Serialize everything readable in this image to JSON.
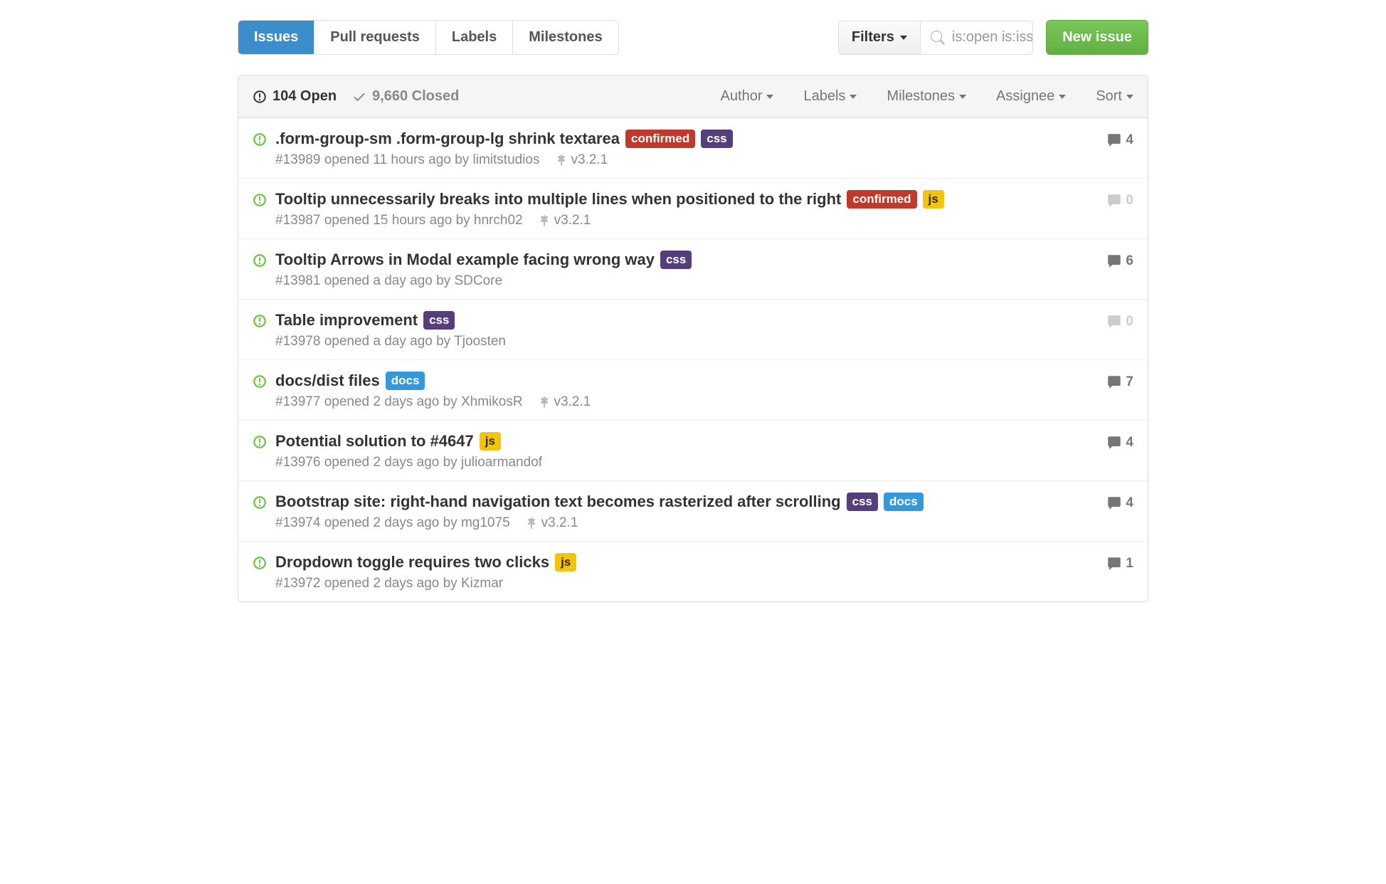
{
  "nav": {
    "issues": "Issues",
    "pull_requests": "Pull requests",
    "labels": "Labels",
    "milestones": "Milestones"
  },
  "filters_button": "Filters",
  "search_value": "is:open is:issue",
  "new_issue_button": "New issue",
  "toolbar": {
    "open_count": "104 Open",
    "closed_count": "9,660 Closed",
    "menus": {
      "author": "Author",
      "labels": "Labels",
      "milestones": "Milestones",
      "assignee": "Assignee",
      "sort": "Sort"
    }
  },
  "label_colors": {
    "confirmed": "#c0392b",
    "css": "#563d7c",
    "js": "#f1c40f",
    "docs": "#3498db"
  },
  "issues": [
    {
      "title": ".form-group-sm .form-group-lg shrink textarea",
      "labels": [
        "confirmed",
        "css"
      ],
      "number": "#13989",
      "opened": "opened 11 hours ago by",
      "author": "limitstudios",
      "milestone": "v3.2.1",
      "comments": "4",
      "has_comments": true
    },
    {
      "title": "Tooltip unnecessarily breaks into multiple lines when positioned to the right",
      "labels": [
        "confirmed",
        "js"
      ],
      "number": "#13987",
      "opened": "opened 15 hours ago by",
      "author": "hnrch02",
      "milestone": "v3.2.1",
      "comments": "0",
      "has_comments": false
    },
    {
      "title": "Tooltip Arrows in Modal example facing wrong way",
      "labels": [
        "css"
      ],
      "number": "#13981",
      "opened": "opened a day ago by",
      "author": "SDCore",
      "milestone": "",
      "comments": "6",
      "has_comments": true
    },
    {
      "title": "Table improvement",
      "labels": [
        "css"
      ],
      "number": "#13978",
      "opened": "opened a day ago by",
      "author": "Tjoosten",
      "milestone": "",
      "comments": "0",
      "has_comments": false
    },
    {
      "title": "docs/dist files",
      "labels": [
        "docs"
      ],
      "number": "#13977",
      "opened": "opened 2 days ago by",
      "author": "XhmikosR",
      "milestone": "v3.2.1",
      "comments": "7",
      "has_comments": true
    },
    {
      "title": "Potential solution to #4647",
      "labels": [
        "js"
      ],
      "number": "#13976",
      "opened": "opened 2 days ago by",
      "author": "julioarmandof",
      "milestone": "",
      "comments": "4",
      "has_comments": true
    },
    {
      "title": "Bootstrap site: right-hand navigation text becomes rasterized after scrolling",
      "labels": [
        "css",
        "docs"
      ],
      "number": "#13974",
      "opened": "opened 2 days ago by",
      "author": "mg1075",
      "milestone": "v3.2.1",
      "comments": "4",
      "has_comments": true
    },
    {
      "title": "Dropdown toggle requires two clicks",
      "labels": [
        "js"
      ],
      "number": "#13972",
      "opened": "opened 2 days ago by",
      "author": "Kizmar",
      "milestone": "",
      "comments": "1",
      "has_comments": true
    }
  ]
}
